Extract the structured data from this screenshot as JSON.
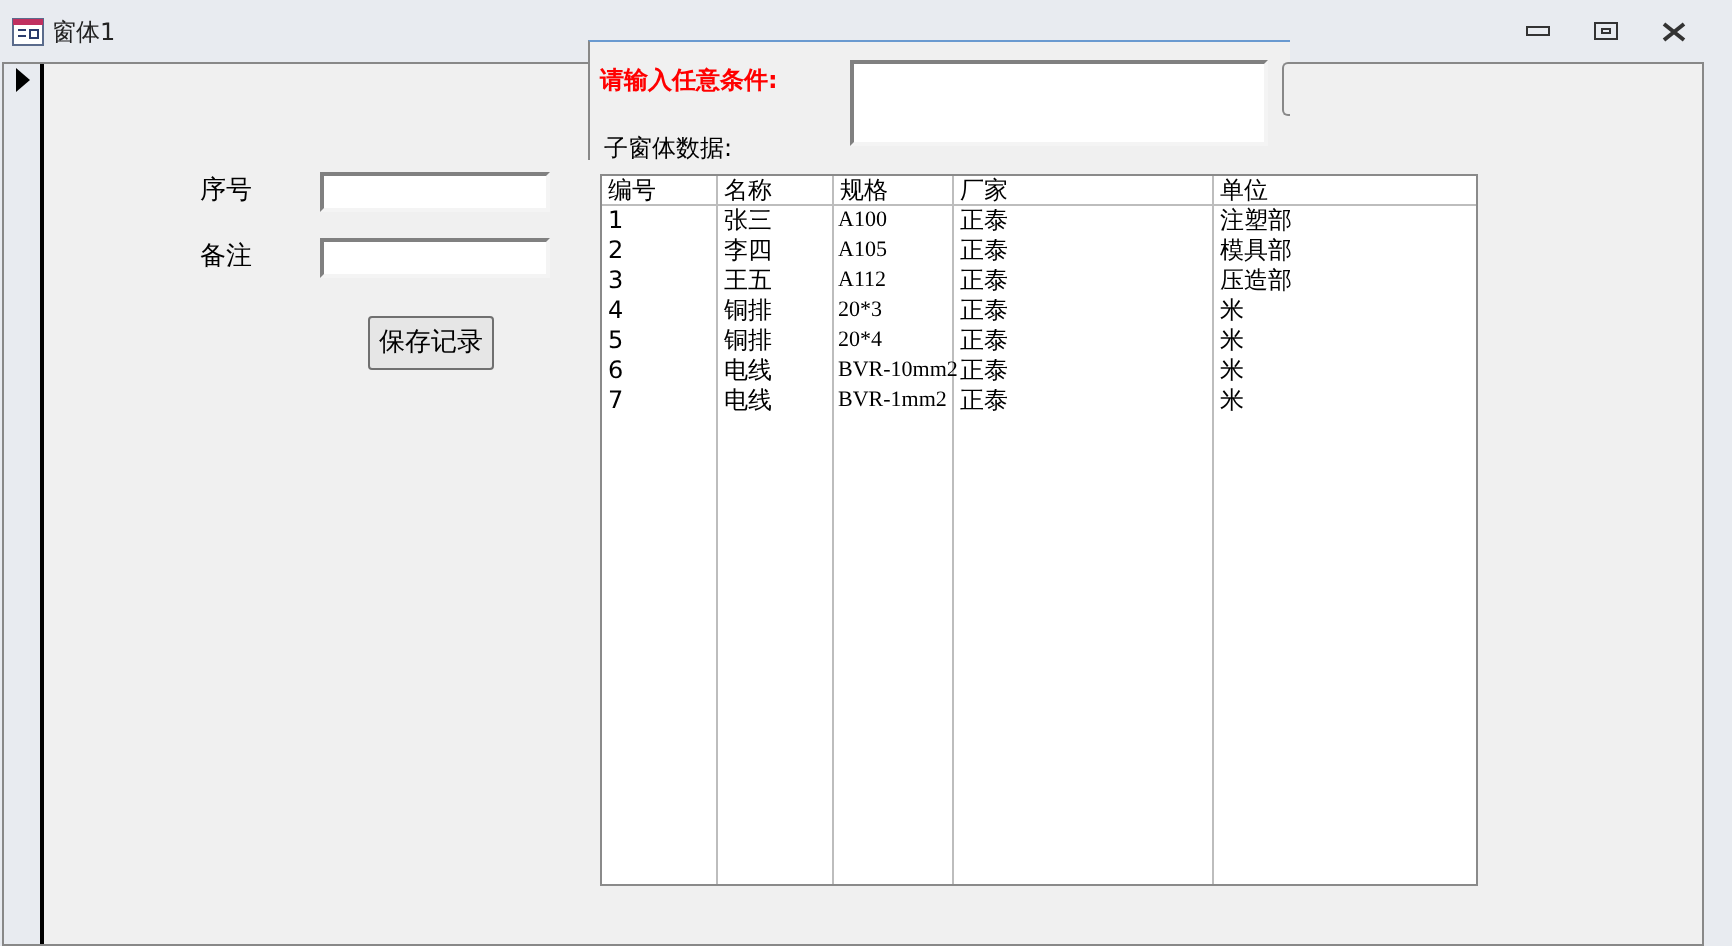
{
  "window": {
    "title": "窗体1"
  },
  "form": {
    "fields": [
      {
        "label": "序号"
      },
      {
        "label": "备注"
      }
    ],
    "save_button": "保存记录"
  },
  "popup": {
    "prompt": "请输入任意条件:",
    "subform_label": "子窗体数据:"
  },
  "table": {
    "columns": [
      "编号",
      "名称",
      "规格",
      "厂家",
      "单位"
    ],
    "rows": [
      [
        "1",
        "张三",
        "A100",
        "正泰",
        "注塑部"
      ],
      [
        "2",
        "李四",
        "A105",
        "正泰",
        "模具部"
      ],
      [
        "3",
        "王五",
        "A112",
        "正泰",
        "压造部"
      ],
      [
        "4",
        "铜排",
        "20*3",
        "正泰",
        "米"
      ],
      [
        "5",
        "铜排",
        "20*4",
        "正泰",
        "米"
      ],
      [
        "6",
        "电线",
        "BVR-10mm2",
        "正泰",
        "米"
      ],
      [
        "7",
        "电线",
        "BVR-1mm2",
        "正泰",
        "米"
      ]
    ]
  }
}
